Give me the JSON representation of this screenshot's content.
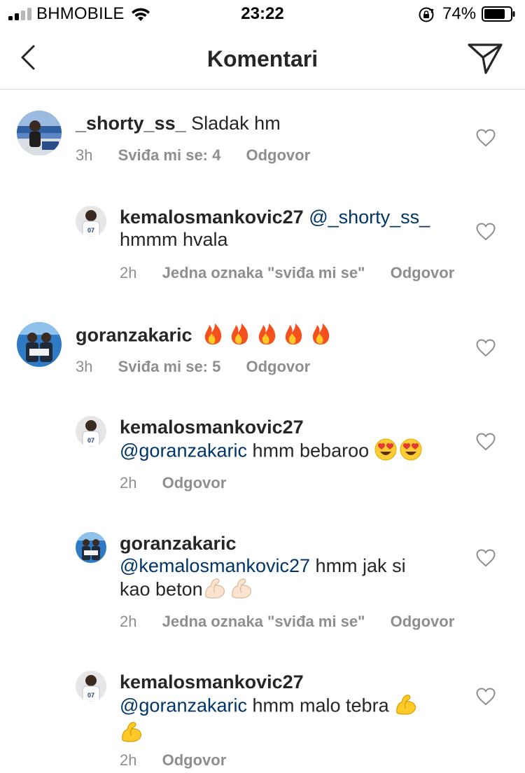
{
  "status_bar": {
    "carrier": "BHMOBILE",
    "time": "23:22",
    "battery_percent": "74%"
  },
  "header": {
    "title": "Komentari"
  },
  "comments": [
    {
      "username": "_shorty_ss_",
      "text": "Sladak hm",
      "time": "3h",
      "likes": "Sviđa mi se: 4",
      "reply": "Odgovor"
    },
    {
      "username": "kemalosmankovic27",
      "mention": "@_shorty_ss_",
      "text": "hmmm hvala",
      "time": "2h",
      "likes": "Jedna oznaka \"sviđa mi se\"",
      "reply": "Odgovor"
    },
    {
      "username": "goranzakaric",
      "emoji": "fire-emoji ×5",
      "time": "3h",
      "likes": "Sviđa mi se: 5",
      "reply": "Odgovor"
    },
    {
      "username": "kemalosmankovic27",
      "mention": "@goranzakaric",
      "text": "hmm bebaroo",
      "emoji": "heart-eyes-emoji ×2",
      "time": "2h",
      "reply": "Odgovor"
    },
    {
      "username": "goranzakaric",
      "mention": "@kemalosmankovic27",
      "text_line1": "hmm jak si",
      "text_line2": "kao beton",
      "emoji": "flexed-biceps-emoji ×2 (light skin)",
      "time": "2h",
      "likes": "Jedna oznaka \"sviđa mi se\"",
      "reply": "Odgovor"
    },
    {
      "username": "kemalosmankovic27",
      "mention": "@goranzakaric",
      "text": "hmm malo tebra",
      "emoji": "flexed-biceps-emoji ×2",
      "time": "2h",
      "reply": "Odgovor"
    }
  ],
  "colors": {
    "text": "#262626",
    "mention": "#003569",
    "meta": "#8e8e8e",
    "divider": "#dbdbdb"
  }
}
